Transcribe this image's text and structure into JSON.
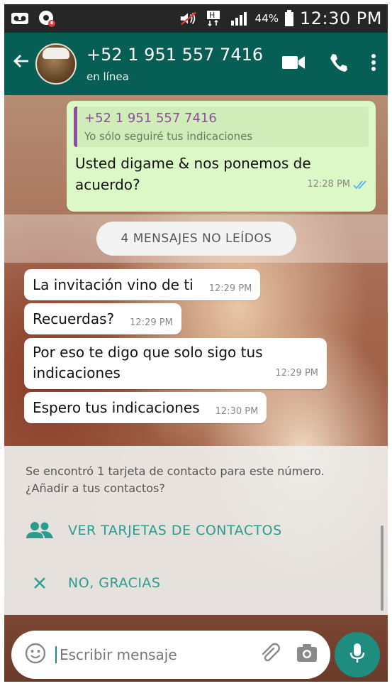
{
  "status_bar": {
    "battery_pct": "44%",
    "clock": "12:30 PM",
    "icons": [
      "voicemail-icon",
      "app-notification-icon",
      "mute-icon",
      "hd-data-icon",
      "signal-icon",
      "battery-icon"
    ]
  },
  "header": {
    "contact_name": "+52 1 951 557 7416",
    "contact_status": "en línea",
    "actions": [
      "video-call-icon",
      "voice-call-icon",
      "more-options-icon"
    ]
  },
  "messages": {
    "outgoing": {
      "quote_name": "+52 1 951 557 7416",
      "quote_text": "Yo sólo seguiré tus indicaciones",
      "line1": "Usted digame & nos ponemos de",
      "line2": "acuerdo?",
      "time": "12:28 PM"
    },
    "unread_label": "4 MENSAJES NO LEÍDOS",
    "incoming": [
      {
        "text": "La invitación vino de ti",
        "time": "12:29 PM"
      },
      {
        "text": "Recuerdas?",
        "time": "12:29 PM"
      },
      {
        "line1": "Por eso te digo que solo sigo tus",
        "line2": "indicaciones",
        "time": "12:29 PM"
      },
      {
        "text": "Espero tus indicaciones",
        "time": "12:30 PM"
      }
    ]
  },
  "contact_prompt": {
    "line1": "Se encontró 1 tarjeta de contacto para este número.",
    "line2": "¿Añadir a tus contactos?",
    "view_cards_label": "VER TARJETAS DE CONTACTOS",
    "dismiss_label": "NO, GRACIAS"
  },
  "composer": {
    "placeholder": "Escribir mensaje"
  },
  "colors": {
    "header": "#075e54",
    "accent": "#1e8c7e",
    "outgoing_bubble": "#dcf8c6",
    "read_ticks": "#4fb3f6"
  }
}
